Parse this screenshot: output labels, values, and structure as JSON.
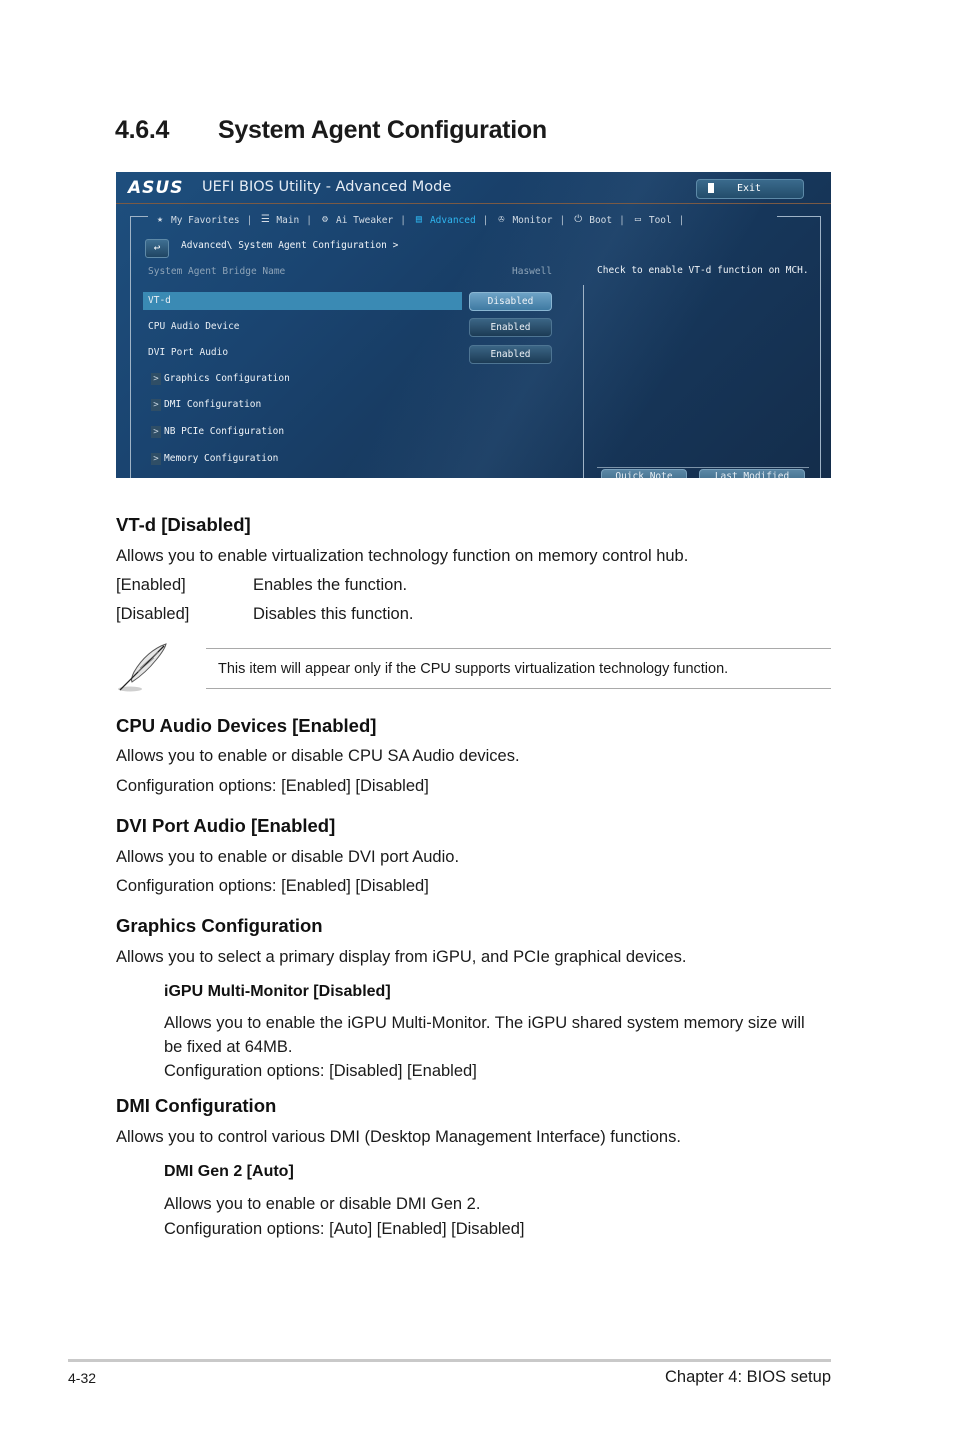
{
  "section": {
    "number": "4.6.4",
    "title": "System Agent Configuration"
  },
  "bios": {
    "logo": "ASUS",
    "title": "UEFI BIOS Utility - Advanced Mode",
    "exit_label": "Exit",
    "menu": [
      {
        "label": "My Favorites",
        "icon": "star-icon",
        "active": false
      },
      {
        "label": "Main",
        "icon": "list-icon",
        "active": false
      },
      {
        "label": "Ai Tweaker",
        "icon": "tweaker-icon",
        "active": false
      },
      {
        "label": "Advanced",
        "icon": "advanced-icon",
        "active": true
      },
      {
        "label": "Monitor",
        "icon": "monitor-icon",
        "active": false
      },
      {
        "label": "Boot",
        "icon": "power-icon",
        "active": false
      },
      {
        "label": "Tool",
        "icon": "tool-icon",
        "active": false
      }
    ],
    "breadcrumb": "Advanced\\ System Agent Configuration >",
    "info_row": {
      "label": "System Agent Bridge Name",
      "value": "Haswell"
    },
    "settings": [
      {
        "label": "VT-d",
        "value": "Disabled",
        "selected": true
      },
      {
        "label": "CPU Audio Device",
        "value": "Enabled",
        "selected": false
      },
      {
        "label": "DVI Port Audio",
        "value": "Enabled",
        "selected": false
      }
    ],
    "submenus": [
      "Graphics Configuration",
      "DMI Configuration",
      "NB PCIe Configuration",
      "Memory Configuration"
    ],
    "help_text": "Check to enable VT-d function on MCH.",
    "bottom_buttons": [
      "Quick Note",
      "Last Modified"
    ]
  },
  "vtd": {
    "heading": "VT-d [Disabled]",
    "description": "Allows you to enable virtualization technology function on memory control hub.",
    "options": [
      {
        "key": "[Enabled]",
        "desc": "Enables the function."
      },
      {
        "key": "[Disabled]",
        "desc": "Disables this function."
      }
    ],
    "note": "This item will appear only if the CPU supports virtualization technology function."
  },
  "cpu_audio": {
    "heading": "CPU Audio Devices [Enabled]",
    "description": "Allows you to enable or disable CPU SA Audio devices.",
    "options": "Configuration options: [Enabled] [Disabled]"
  },
  "dvi_audio": {
    "heading": "DVI Port Audio [Enabled]",
    "description": "Allows you to enable or disable DVI port Audio.",
    "options": "Configuration options: [Enabled] [Disabled]"
  },
  "graphics": {
    "heading": "Graphics Configuration",
    "description": "Allows you to select a primary display from iGPU, and PCIe graphical devices.",
    "sub_heading": "iGPU Multi-Monitor [Disabled]",
    "sub_description": "Allows you to enable the iGPU Multi-Monitor. The iGPU shared system memory size will be fixed at 64MB.",
    "sub_options": "Configuration options: [Disabled] [Enabled]"
  },
  "dmi": {
    "heading": "DMI Configuration",
    "description": "Allows you to control various DMI (Desktop Management Interface) functions.",
    "sub_heading": "DMI Gen 2 [Auto]",
    "sub_description": "Allows you to enable or disable DMI Gen 2.",
    "sub_options": "Configuration options: [Auto] [Enabled] [Disabled]"
  },
  "footer": {
    "page": "4-32",
    "chapter": "Chapter 4: BIOS setup"
  }
}
